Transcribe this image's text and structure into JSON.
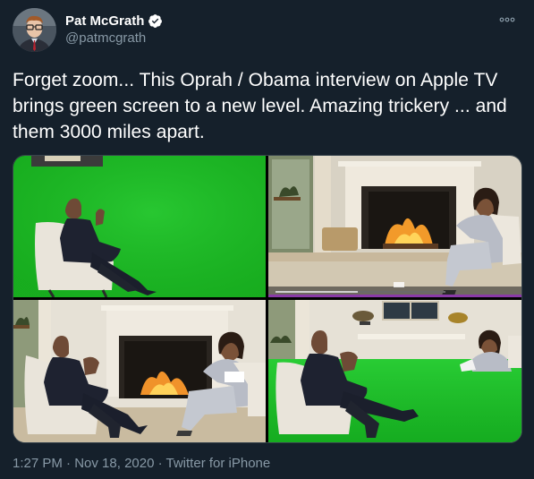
{
  "tweet": {
    "display_name": "Pat McGrath",
    "handle": "@patmcgrath",
    "verified": true,
    "avatar_icon": "profile-photo",
    "more_icon": "more-horizontal-icon",
    "text": "Forget zoom... This Oprah / Obama interview on Apple TV brings green screen to a new level. Amazing trickery ... and them 3000 miles apart.",
    "media_count": 4
  },
  "meta": {
    "time": "1:27 PM",
    "separator": " · ",
    "date": "Nov 18, 2020",
    "source": "Twitter for iPhone"
  },
  "colors": {
    "background": "#15202b",
    "secondary_text": "#8899a6",
    "verified_blue": "#1da1f2",
    "green_screen": "#1fbf2a"
  }
}
